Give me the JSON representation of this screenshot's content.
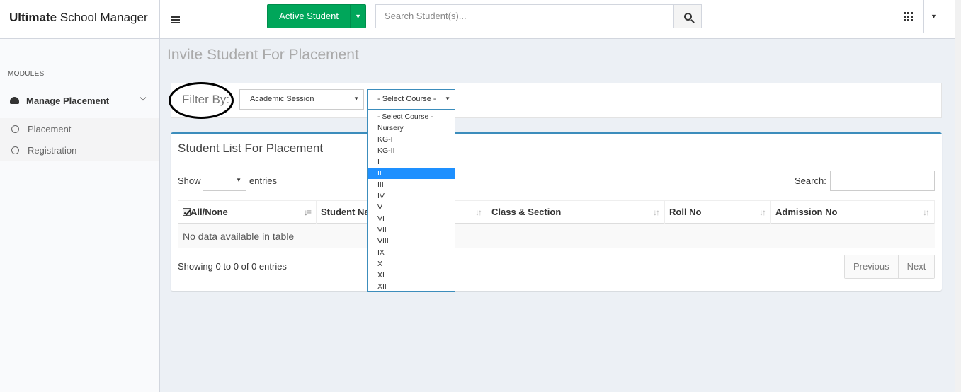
{
  "app": {
    "title_bold": "Ultimate",
    "title_rest": " School Manager"
  },
  "topbar": {
    "active_student_label": "Active Student",
    "search_placeholder": "Search Student(s)..."
  },
  "sidebar": {
    "section_label": "MODULES",
    "menu_title": "Manage Placement",
    "items": [
      {
        "label": "Placement"
      },
      {
        "label": "Registration"
      }
    ]
  },
  "page": {
    "title": "Invite Student For Placement"
  },
  "filter": {
    "label": "Filter By:",
    "session_value": "Academic Session",
    "course_value": "- Select Course -",
    "course_options": [
      "- Select Course -",
      "Nursery",
      "KG-I",
      "KG-II",
      "I",
      "II",
      "III",
      "IV",
      "V",
      "VI",
      "VII",
      "VIII",
      "IX",
      "X",
      "XI",
      "XII"
    ],
    "course_highlighted": "II"
  },
  "student_list": {
    "title": "Student List For Placement",
    "show_label": "Show",
    "entries_label": "entries",
    "search_label": "Search:",
    "columns": [
      "All/None",
      "Student Name",
      "Class & Section",
      "Roll No",
      "Admission No"
    ],
    "empty_message": "No data available in table",
    "info": "Showing 0 to 0 of 0 entries",
    "previous_label": "Previous",
    "next_label": "Next"
  },
  "colors": {
    "accent": "#3c8dbc",
    "success": "#00a65a",
    "highlight": "#1e90ff"
  }
}
